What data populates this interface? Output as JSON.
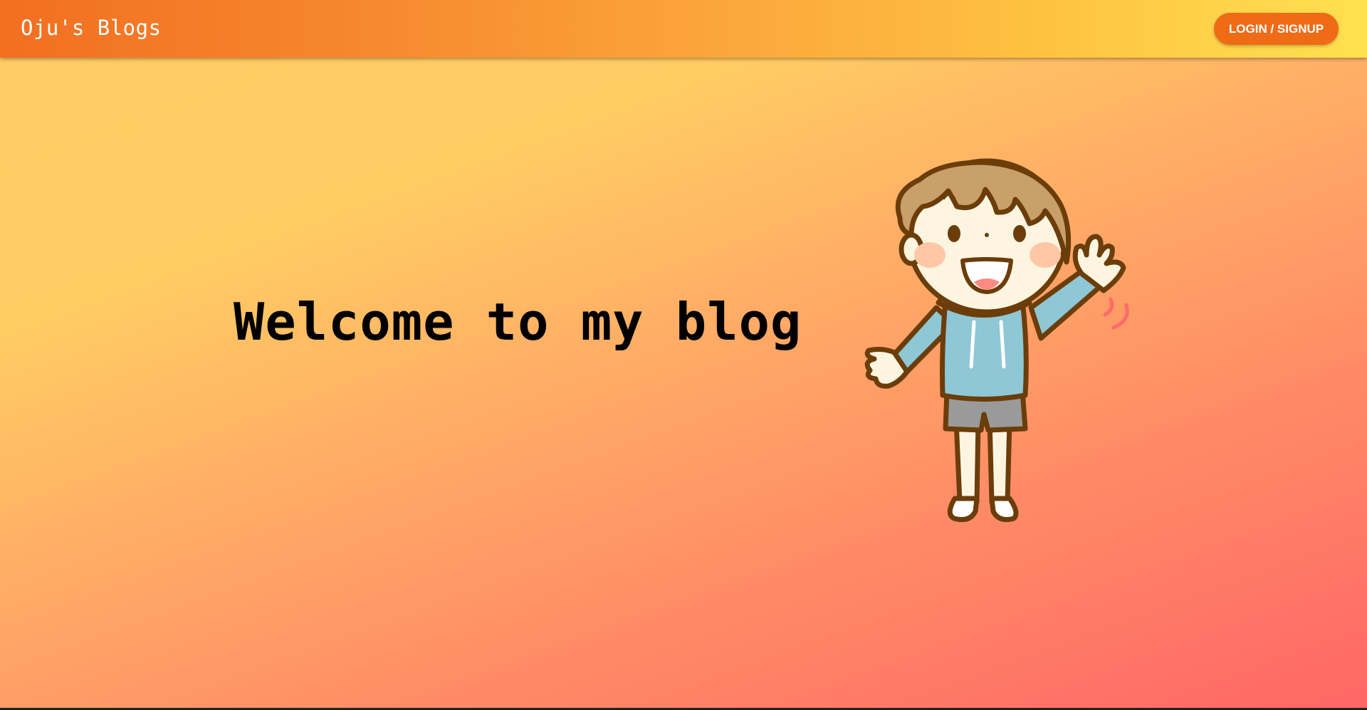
{
  "header": {
    "brand": "Oju's Blogs",
    "login_label": "LOGIN / SIGNUP"
  },
  "hero": {
    "title": "Welcome to my blog",
    "illustration": "waving-boy-illustration"
  },
  "colors": {
    "header_start": "#f26f21",
    "header_end": "#ffe14f",
    "button": "#ef6b16",
    "background_top": "#ffcc66",
    "background_bottom": "#ff6666"
  }
}
